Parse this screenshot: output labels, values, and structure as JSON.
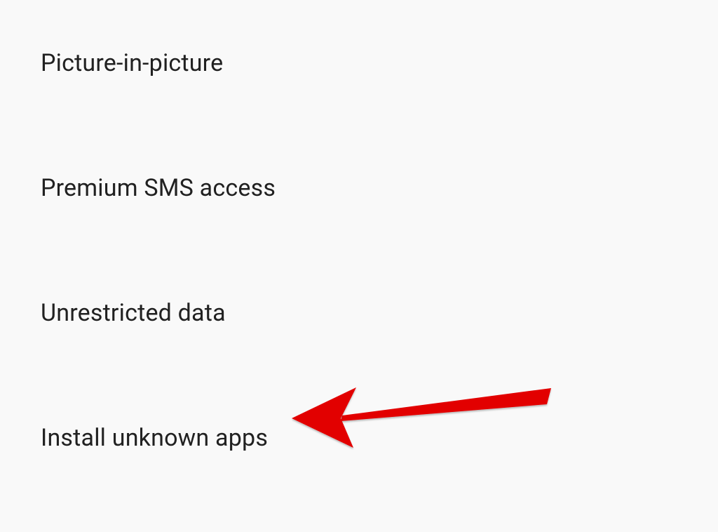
{
  "settings": {
    "items": [
      {
        "label": "Picture-in-picture"
      },
      {
        "label": "Premium SMS access"
      },
      {
        "label": "Unrestricted data"
      },
      {
        "label": "Install unknown apps"
      }
    ]
  },
  "annotation": {
    "arrow_color": "#e20000"
  }
}
